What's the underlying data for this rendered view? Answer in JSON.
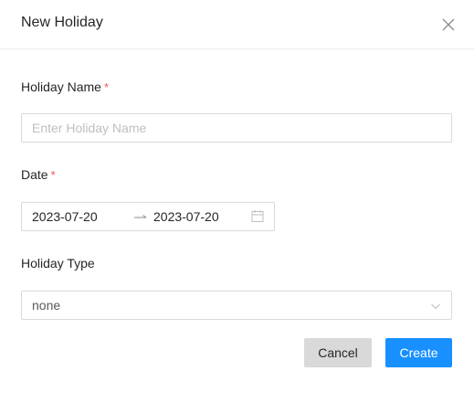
{
  "dialog": {
    "title": "New Holiday",
    "close_icon": "close-icon"
  },
  "form": {
    "name": {
      "label": "Holiday Name",
      "required_mark": "*",
      "value": "",
      "placeholder": "Enter Holiday Name"
    },
    "date": {
      "label": "Date",
      "required_mark": "*",
      "start": "2023-07-20",
      "end": "2023-07-20",
      "separator_icon": "arrow-right-icon",
      "calendar_icon": "calendar-icon"
    },
    "type": {
      "label": "Holiday Type",
      "selected": "none",
      "dropdown_icon": "chevron-down-icon"
    }
  },
  "actions": {
    "cancel_label": "Cancel",
    "create_label": "Create"
  },
  "colors": {
    "primary": "#1890ff",
    "required": "#ff4d4f",
    "cancel_bg": "#d9d9d9",
    "border": "#d9d9d9"
  }
}
